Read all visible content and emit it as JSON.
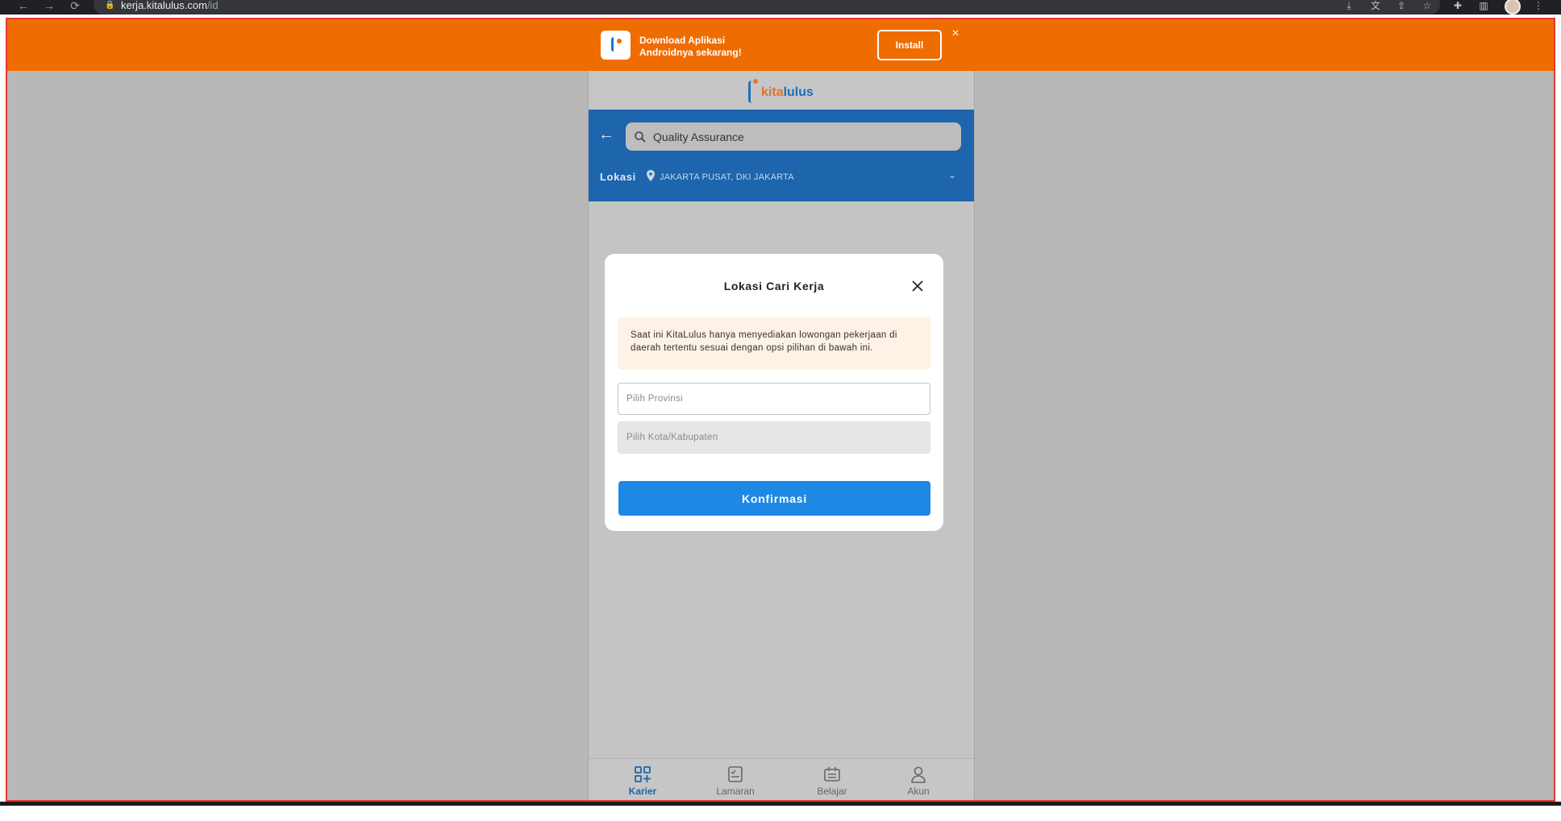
{
  "browser": {
    "url_host": "kerja.kitalulus.com",
    "url_path": "/id"
  },
  "banner": {
    "text_line1": "Download Aplikasi",
    "text_line2": "Androidnya sekarang!",
    "install_label": "Install"
  },
  "app": {
    "logo_kita": "kita",
    "logo_lulus": "lulus",
    "search": {
      "value": "Quality Assurance"
    },
    "location": {
      "label": "Lokasi",
      "value": "JAKARTA PUSAT, DKI JAKARTA"
    }
  },
  "modal": {
    "title": "Lokasi Cari Kerja",
    "notice": "Saat ini KitaLulus hanya menyediakan lowongan pekerjaan di daerah tertentu sesuai dengan opsi pilihan di bawah ini.",
    "province_placeholder": "Pilih Provinsi",
    "city_placeholder": "Pilih Kota/Kabupaten",
    "confirm_label": "Konfirmasi"
  },
  "bottom_nav": [
    {
      "label": "Karier",
      "icon": "career-grid-icon",
      "active": true
    },
    {
      "label": "Lamaran",
      "icon": "application-checklist-icon",
      "active": false
    },
    {
      "label": "Belajar",
      "icon": "learn-calendar-icon",
      "active": false
    },
    {
      "label": "Akun",
      "icon": "account-person-icon",
      "active": false
    }
  ],
  "colors": {
    "banner": "#ef6c00",
    "primary": "#1d65ad",
    "button": "#1e88e5"
  }
}
